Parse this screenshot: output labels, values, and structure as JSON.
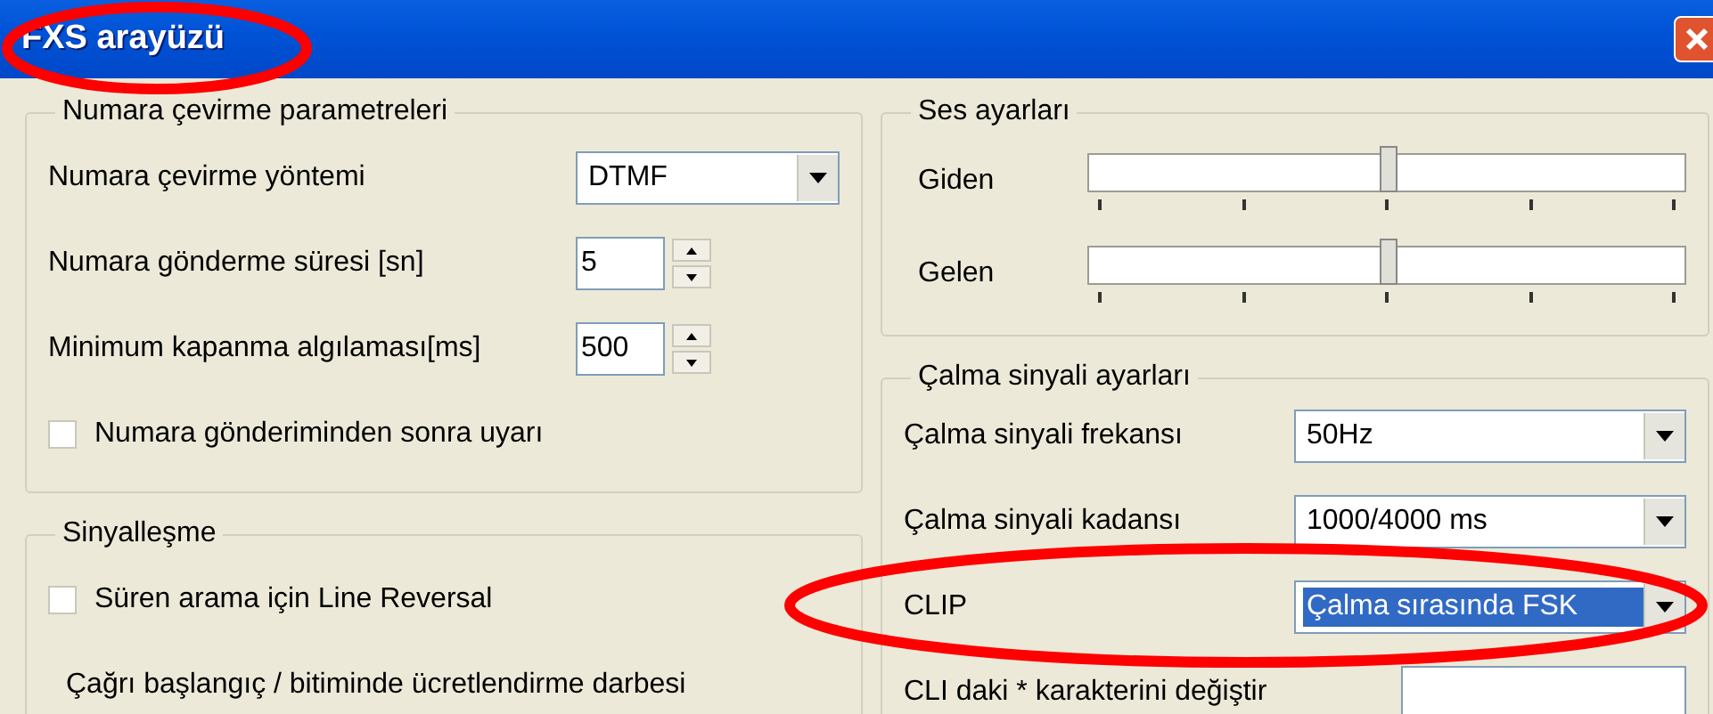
{
  "window": {
    "title": "FXS arayüzü"
  },
  "dialing": {
    "title": "Numara çevirme parametreleri",
    "rows": [
      {
        "kind": "dropdown",
        "label": "Numara çevirme yöntemi",
        "value": "DTMF"
      },
      {
        "kind": "spinner",
        "label": "Numara gönderme süresi [sn]",
        "value": "5"
      },
      {
        "kind": "spinner",
        "label": "Minimum kapanma algılaması[ms]",
        "value": "500"
      },
      {
        "kind": "checkbox",
        "label": "Numara gönderiminden sonra uyarı",
        "checked": false
      }
    ]
  },
  "signaling": {
    "title": "Sinyalleşme",
    "rows": [
      {
        "kind": "checkbox",
        "label": "Süren arama için Line Reversal",
        "checked": false
      },
      {
        "kind": "text",
        "label": "Çağrı başlangıç / bitiminde ücretlendirme darbesi"
      }
    ]
  },
  "sound": {
    "title": "Ses ayarları",
    "sliders": [
      {
        "label": "Giden",
        "level": 0.5
      },
      {
        "label": "Gelen",
        "level": 0.5
      }
    ]
  },
  "ringing": {
    "title": "Çalma sinyali ayarları",
    "rows": [
      {
        "kind": "dropdown",
        "label": "Çalma sinyali frekansı",
        "value": "50Hz",
        "selected": false
      },
      {
        "kind": "dropdown",
        "label": "Çalma sinyali kadansı",
        "value": "1000/4000 ms",
        "selected": false
      },
      {
        "kind": "dropdown",
        "label": "CLIP",
        "value": "Çalma sırasında FSK",
        "selected": true
      },
      {
        "kind": "field",
        "label": "CLI daki * karakterini değiştir"
      }
    ]
  }
}
